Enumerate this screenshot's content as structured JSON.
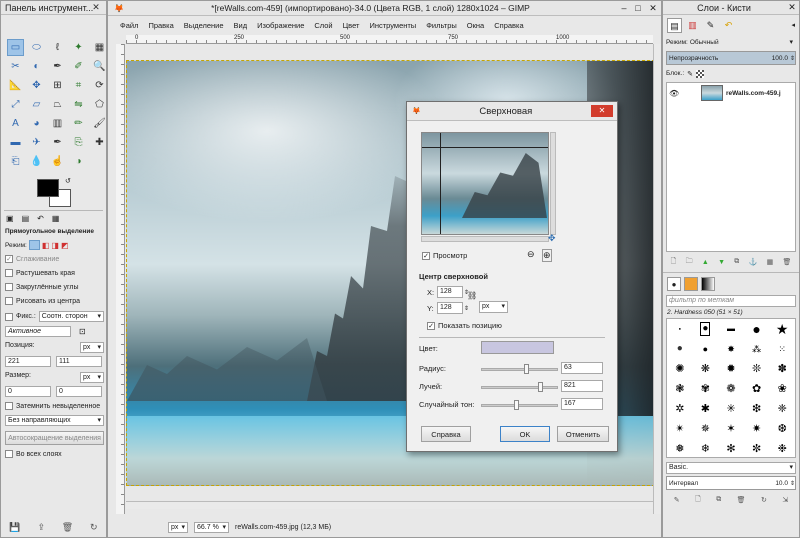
{
  "toolbox": {
    "title": "Панель инструмент...",
    "section_title": "Прямоугольное выделение",
    "mode_label": "Режим:",
    "antialias_label": "Сглаживание",
    "feather_label": "Растушевать края",
    "rounded_label": "Закруглённые углы",
    "from_center_label": "Рисовать из центра",
    "fixed_label": "Фикс.:",
    "fixed_value": "Соотн. сторон",
    "active_value": "Активное",
    "position_label": "Позиция:",
    "position_unit": "px",
    "pos_x": "221",
    "pos_y": "111",
    "size_label": "Размер:",
    "size_unit": "px",
    "size_w": "0",
    "size_h": "0",
    "darken_label": "Затемнить невыделенное",
    "guides_value": "Без направляющих",
    "autoshrink_label": "Автосокращение выделения",
    "all_layers_label": "Во всех слоях"
  },
  "image_window": {
    "title": "*[reWalls.com-459] (импортировано)-34.0 (Цвета RGB, 1 слой) 1280x1024 – GIMP",
    "menu": [
      "Файл",
      "Правка",
      "Выделение",
      "Вид",
      "Изображение",
      "Слой",
      "Цвет",
      "Инструменты",
      "Фильтры",
      "Окна",
      "Справка"
    ],
    "ruler_ticks": [
      "0",
      "250",
      "500",
      "750",
      "1000"
    ],
    "status_unit": "px",
    "zoom": "66.7 %",
    "status_text": "reWalls.com-459.jpg (12,3 МБ)"
  },
  "dialog": {
    "title": "Сверхновая",
    "preview_label": "Просмотр",
    "center_heading": "Центр сверхновой",
    "x_label": "X:",
    "x_value": "128",
    "y_label": "Y:",
    "y_value": "128",
    "unit": "px",
    "show_position_label": "Показать позицию",
    "color_label": "Цвет:",
    "color_value": "#c8c6e0",
    "radius_label": "Радиус:",
    "radius_value": "63",
    "rays_label": "Лучей:",
    "rays_value": "821",
    "hue_label": "Случайный тон:",
    "hue_value": "167",
    "help_button": "Справка",
    "ok_button": "OK",
    "cancel_button": "Отменить"
  },
  "layers": {
    "title": "Слои - Кисти",
    "mode_label": "Режим:",
    "mode_value": "Обычный",
    "opacity_label": "Непрозрачность",
    "opacity_value": "100.0",
    "lock_label": "Блок.:",
    "layer_name": "reWalls.com-459.j",
    "brush_filter_placeholder": "фильтр по меткам",
    "brush_name": "2. Hardness 050 (51 × 51)",
    "brush_preset": "Basic.",
    "spacing_label": "Интервал",
    "spacing_value": "10.0"
  },
  "colors": {
    "accent": "#3c82c8",
    "close_red": "#d23c2c",
    "selection_blue": "#9ec4e8"
  }
}
